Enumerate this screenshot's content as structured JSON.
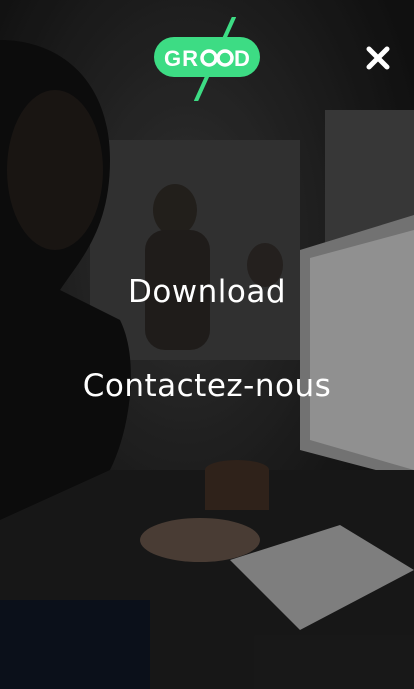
{
  "brand": {
    "logo_text": "GROOD",
    "accent_color": "#3ddc84"
  },
  "header": {
    "close_icon": "close-icon"
  },
  "menu": {
    "items": [
      {
        "label": "Download"
      },
      {
        "label": "Contactez-nous"
      }
    ]
  }
}
